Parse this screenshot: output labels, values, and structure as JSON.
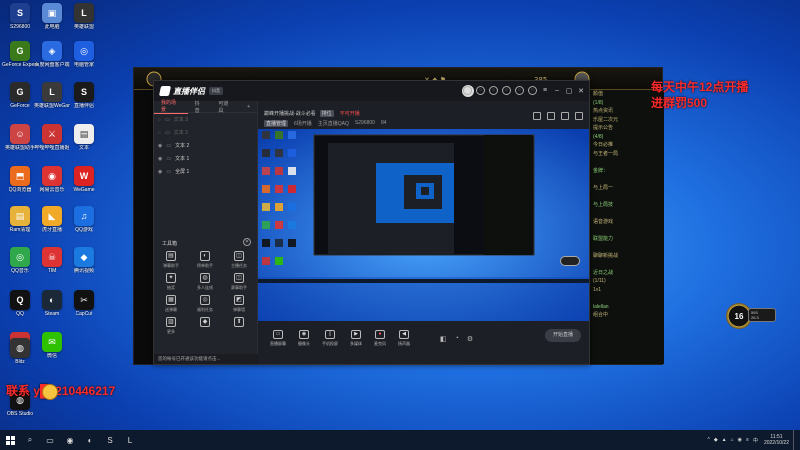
{
  "desktop": {
    "icons": [
      {
        "label": "S296800",
        "color": "#1e3f8f",
        "glyph": "S"
      },
      {
        "label": "此电脑",
        "color": "#5a8ad6",
        "glyph": "▣"
      },
      {
        "label": "英雄联盟",
        "color": "#333",
        "glyph": "L"
      },
      {
        "label": "GeForce Experience",
        "color": "#3a7a1a",
        "glyph": "G"
      },
      {
        "label": "百度网盘客户端",
        "color": "#2a6be2",
        "glyph": "◈"
      },
      {
        "label": "电脑管家",
        "color": "#1d5fe0",
        "glyph": "◎"
      },
      {
        "label": "GeForce",
        "color": "#2a2a2a",
        "glyph": "G"
      },
      {
        "label": "英雄联盟WeGame版",
        "color": "#3a3a3a",
        "glyph": "L"
      },
      {
        "label": "直播伴侣",
        "color": "#1a1a1a",
        "glyph": "S"
      },
      {
        "label": "英雄联盟助手",
        "color": "#c44",
        "glyph": "☺"
      },
      {
        "label": "哔哩哔哩直播姬",
        "color": "#c33",
        "glyph": "⚔"
      },
      {
        "label": "文本",
        "color": "#eee",
        "glyph": "▤"
      },
      {
        "label": "QQ浏览器",
        "color": "#eb6b1c",
        "glyph": "⬒"
      },
      {
        "label": "网易云音乐",
        "color": "#d33",
        "glyph": "◉"
      },
      {
        "label": "WeGame",
        "color": "#d22",
        "glyph": "W"
      },
      {
        "label": "Ram清理",
        "color": "#e6b23a",
        "glyph": "▤"
      },
      {
        "label": "虎牙直播",
        "color": "#f1a928",
        "glyph": "◣"
      },
      {
        "label": "QQ游戏",
        "color": "#1b6fe0",
        "glyph": "♫"
      },
      {
        "label": "QQ音乐",
        "color": "#2ea84a",
        "glyph": "◎"
      },
      {
        "label": "TIM",
        "color": "#d33",
        "glyph": "☠"
      },
      {
        "label": "腾讯视频",
        "color": "#1a7ae0",
        "glyph": "◆"
      },
      {
        "label": "QQ",
        "color": "#111",
        "glyph": "Q"
      },
      {
        "label": "Steam",
        "color": "#1b2838",
        "glyph": "◐"
      },
      {
        "label": "CapCut",
        "color": "#111",
        "glyph": "✂"
      },
      {
        "label": "bilibili",
        "color": "#c33",
        "glyph": "▣"
      },
      {
        "label": "微信",
        "color": "#2dc100",
        "glyph": "✉"
      },
      {
        "label": "Blitz",
        "color": "#333",
        "glyph": "◍"
      },
      {
        "label": "OBS Studio",
        "color": "#111",
        "glyph": "◍"
      }
    ]
  },
  "game": {
    "right_panel_rows": [
      "颜值",
      "(1/8)",
      "热点资讯",
      "乐屋二次元",
      "提示公告",
      "(4/8)",
      "今日必推",
      "与王者一局",
      "",
      "金牌：",
      "",
      "与上局一",
      "",
      "与上局技",
      "",
      "语音游戏",
      "",
      "联盟能力",
      "",
      "聊聊新挑战",
      "",
      "近日之战",
      "(1/11)",
      "1v1",
      "",
      "lalellan",
      "组合中"
    ]
  },
  "stream_app": {
    "brand": "直播伴侣",
    "badge": "抖音",
    "scene_tabs": [
      "我的场景",
      "抖音",
      "可道具"
    ],
    "sources": [
      {
        "label": "文本 3",
        "visible": false
      },
      {
        "label": "文本 2",
        "visible": false
      },
      {
        "label": "文本 2",
        "visible": true
      },
      {
        "label": "文本 1",
        "visible": true
      },
      {
        "label": "全屏 1",
        "visible": true
      }
    ],
    "tools_title": "工具箱",
    "tools": [
      {
        "label": "弹幕助手",
        "glyph": "▤"
      },
      {
        "label": "榜单助手",
        "glyph": "◐"
      },
      {
        "label": "主播任务",
        "glyph": "◫"
      },
      {
        "label": "抽奖",
        "glyph": "✦"
      },
      {
        "label": "多人连线",
        "glyph": "◍"
      },
      {
        "label": "赛事助手",
        "glyph": "◫"
      },
      {
        "label": "送弹幕",
        "glyph": "▦"
      },
      {
        "label": "福利任务",
        "glyph": "◎"
      },
      {
        "label": "弹幕墙",
        "glyph": "◩"
      },
      {
        "label": "更多",
        "glyph": "▨"
      },
      {
        "label": "",
        "glyph": "◆"
      },
      {
        "label": "",
        "glyph": "⬆"
      }
    ],
    "stream_title": "巅峰开播挑战·战斗必看",
    "stream_tag": "排位",
    "stream_red_tag": "不可开播",
    "meta_items": [
      "直播管理",
      "6场开播",
      "主页直播QAQ",
      "S296800",
      "84"
    ],
    "status_text": "您的帐号已开通该功能请点击...",
    "preview_buttons": [
      {
        "label": "直播屏幕",
        "glyph": "▭"
      },
      {
        "label": "摄像头",
        "glyph": "◉"
      },
      {
        "label": "手机投屏",
        "glyph": "▯"
      },
      {
        "label": "多媒体",
        "glyph": "▶"
      },
      {
        "label": "麦克风",
        "glyph": "●"
      },
      {
        "label": "扬声器",
        "glyph": "◀"
      }
    ],
    "start_button": "开始直播"
  },
  "overlays": {
    "line1": "每天中午12点开播",
    "line2": "进群罚500",
    "line3": "联系 y█a210446217"
  },
  "widgets": {
    "level": "16",
    "level_bar_1": "593",
    "level_bar_2": "26.3"
  },
  "taskbar": {
    "items": [
      "⌕",
      "▭",
      "◉",
      "◐",
      "S",
      "L"
    ],
    "tray_icons": [
      "^",
      "◆",
      "▲",
      "⌂",
      "◉",
      "≡",
      "中"
    ],
    "time": "11:51",
    "date": "2022/10/22"
  }
}
